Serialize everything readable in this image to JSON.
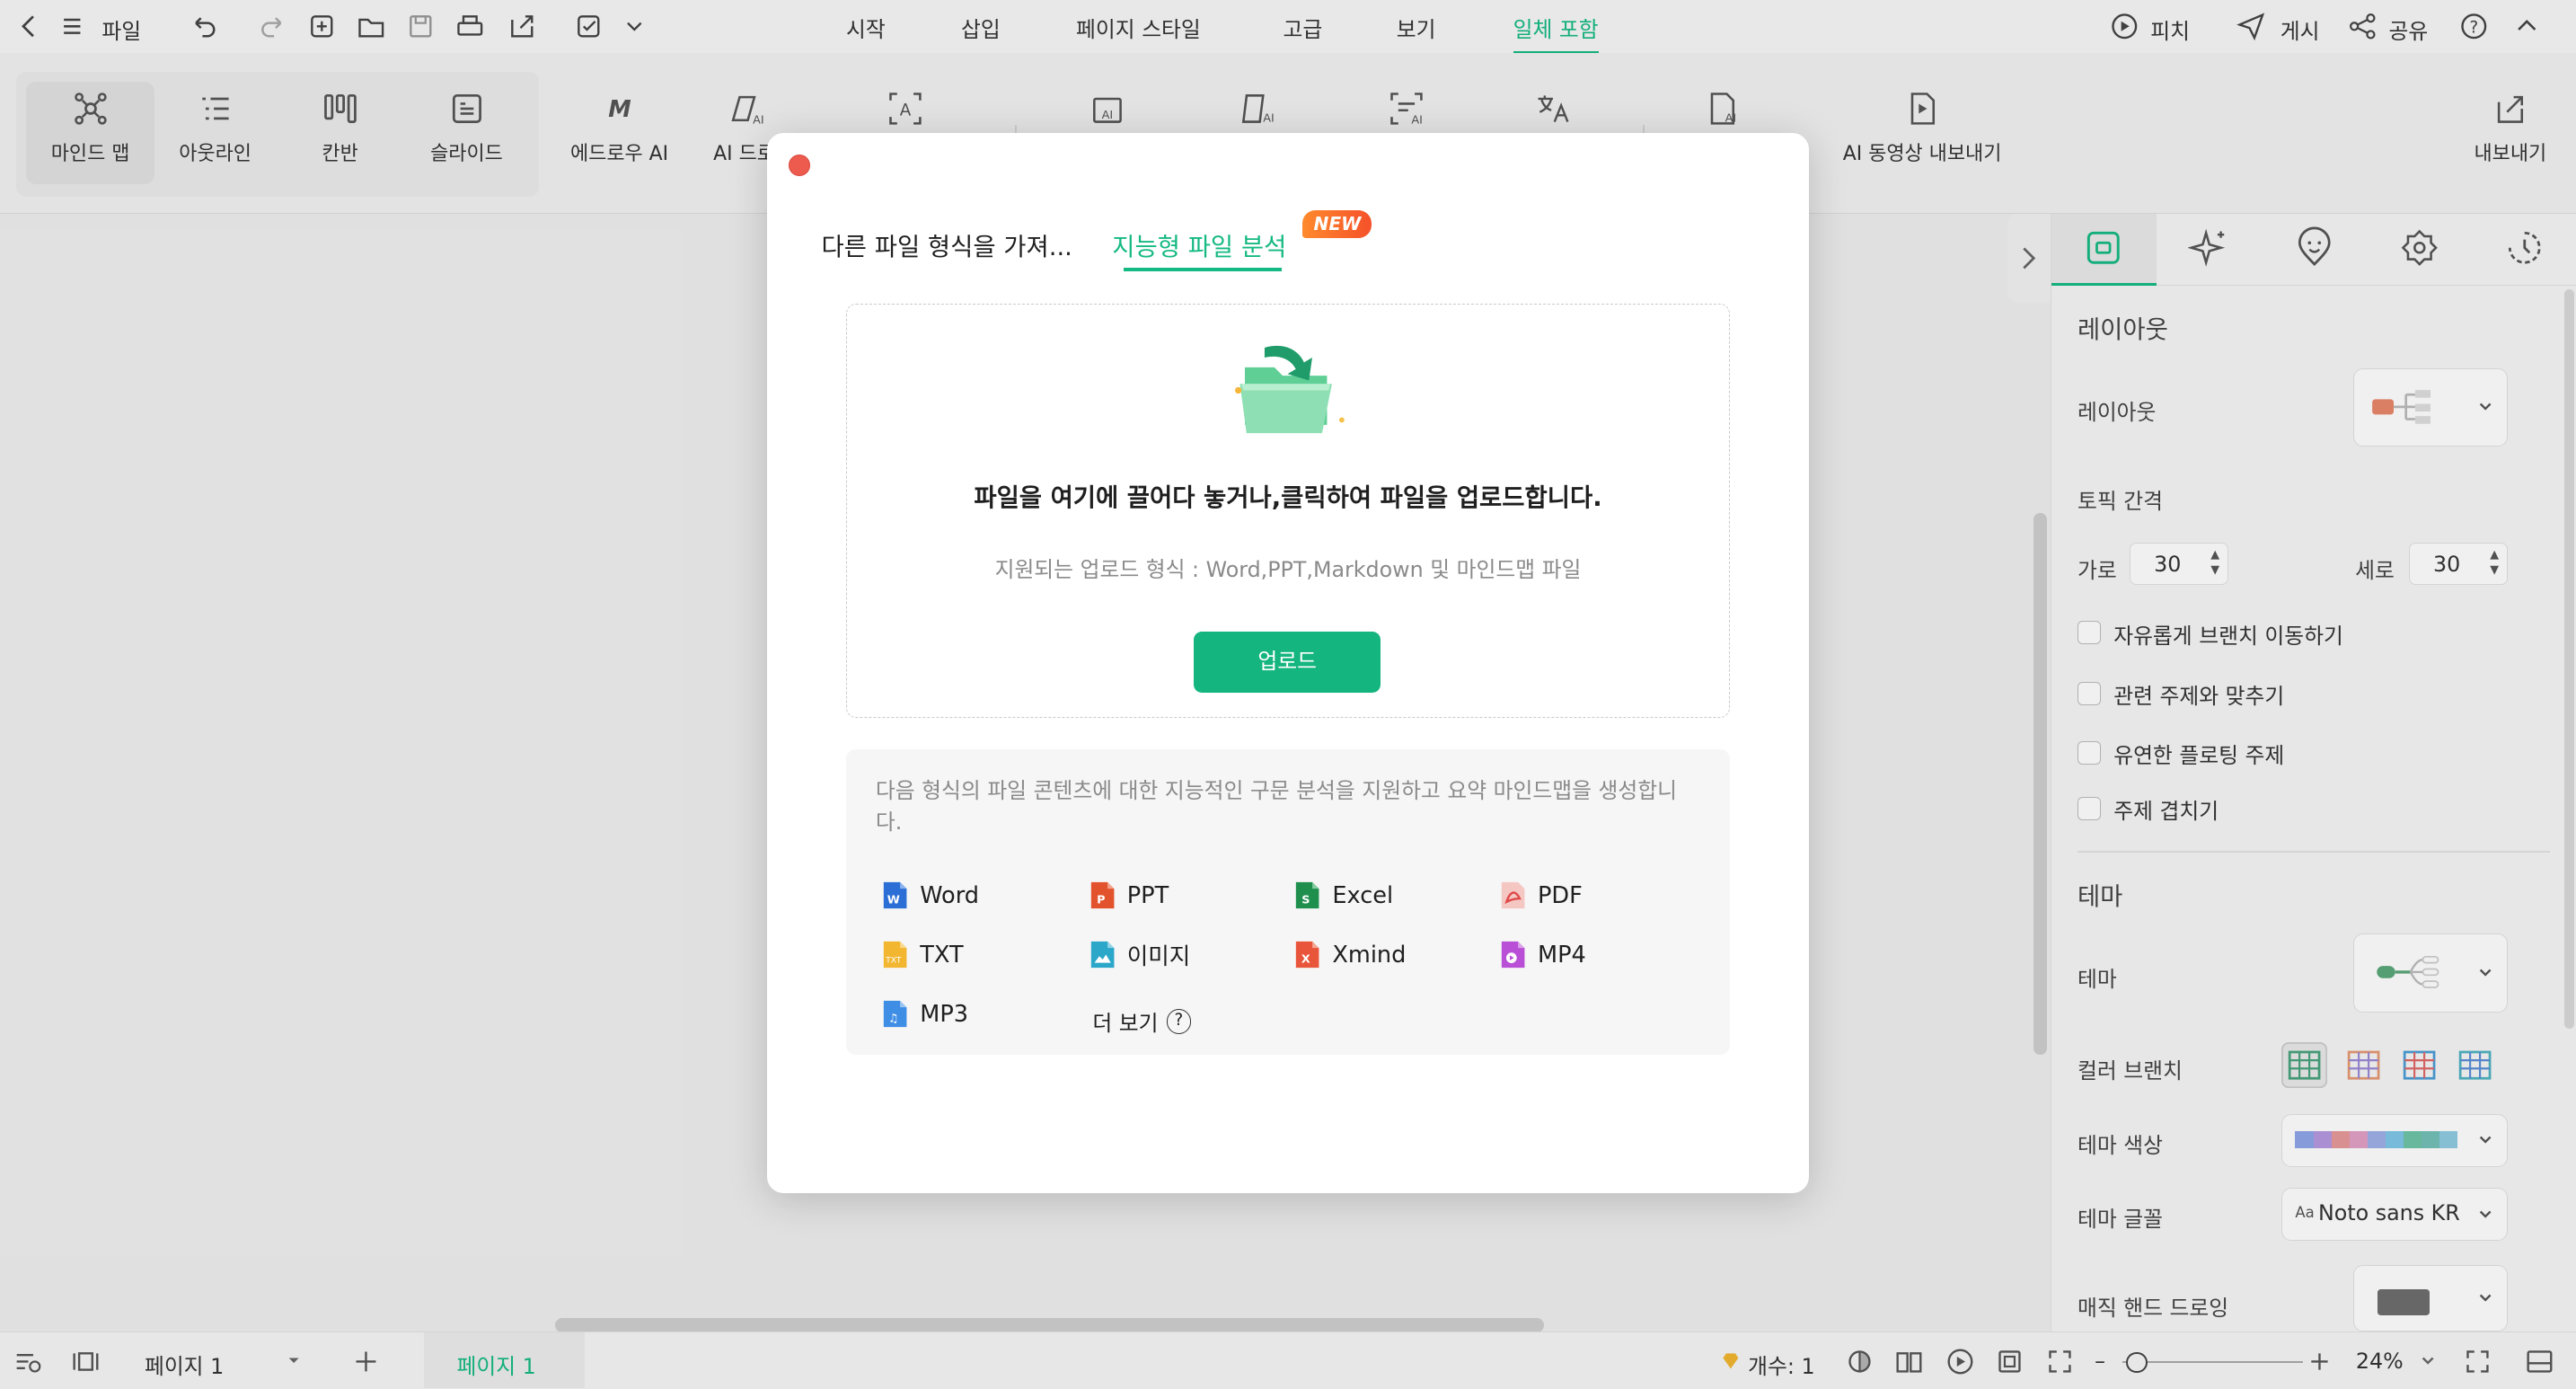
{
  "topbar": {
    "file_label": "파일",
    "menu_tabs": [
      "시작",
      "삽입",
      "페이지 스타일",
      "고급",
      "보기",
      "일체 포함"
    ],
    "active_tab": "일체 포함",
    "pitch_label": "피치",
    "publish_label": "게시",
    "share_label": "공유"
  },
  "ribbon": {
    "view_buttons": [
      "마인드 맵",
      "아웃라인",
      "칸반",
      "슬라이드"
    ],
    "ai_buttons": [
      "에드로우 AI",
      "AI 드로",
      "AI 동영상 내보내기"
    ],
    "export_label": "내보내기"
  },
  "modal": {
    "tabs": [
      "다른 파일 형식을 가져...",
      "지능형 파일 분석"
    ],
    "active_tab": "지능형 파일 분석",
    "new_badge": "NEW",
    "drop_title": "파일을 여기에 끌어다 놓거나,클릭하여 파일을 업로드합니다.",
    "drop_subtitle": "지원되는 업로드 형식 : Word,PPT,Markdown 및 마인드맵 파일",
    "upload_button": "업로드",
    "info_text": "다음 형식의 파일 콘텐츠에 대한 지능적인 구문 분석을 지원하고 요약 마인드맵을 생성합니다.",
    "file_types": [
      {
        "label": "Word",
        "color": "#2b6fd6"
      },
      {
        "label": "PPT",
        "color": "#e2532d"
      },
      {
        "label": "Excel",
        "color": "#1f8f4e"
      },
      {
        "label": "PDF",
        "color": "#e04848"
      },
      {
        "label": "TXT",
        "color": "#f2b630"
      },
      {
        "label": "이미지",
        "color": "#2aa7c9"
      },
      {
        "label": "Xmind",
        "color": "#e9553a"
      },
      {
        "label": "MP4",
        "color": "#b94fd6"
      },
      {
        "label": "MP3",
        "color": "#3f8ee6"
      }
    ],
    "more_label": "더 보기",
    "more_icon": "?"
  },
  "panel": {
    "layout_section": "레이아웃",
    "layout_label": "레이아웃",
    "topic_spacing": "토픽 간격",
    "horizontal_label": "가로",
    "horizontal_value": "30",
    "vertical_label": "세로",
    "vertical_value": "30",
    "checkboxes": [
      "자유롭게 브랜치 이동하기",
      "관련 주제와 맞추기",
      "유연한 플로팅 주제",
      "주제 겹치기"
    ],
    "theme_section": "테마",
    "theme_label": "테마",
    "color_branch_label": "컬러 브랜치",
    "theme_color_label": "테마 색상",
    "theme_font_label": "테마 글꼴",
    "theme_font_value": "Noto sans KR",
    "font_prefix": "Aa",
    "hand_drawing_label": "매직 핸드 드로잉",
    "theme_colors": [
      "#8fa6e8",
      "#b59ae0",
      "#e79a9a",
      "#e2a1c6",
      "#9fb0e8",
      "#7fc6e8",
      "#6fc4a8",
      "#74c0b8",
      "#8fcbe2"
    ]
  },
  "statusbar": {
    "page_select": "페이지 1",
    "page_tab": "페이지 1",
    "count_label": "개수: 1",
    "zoom": "24%"
  },
  "colors": {
    "accent": "#15b983",
    "close": "#ed5a4e",
    "badge": "#f5512a"
  }
}
